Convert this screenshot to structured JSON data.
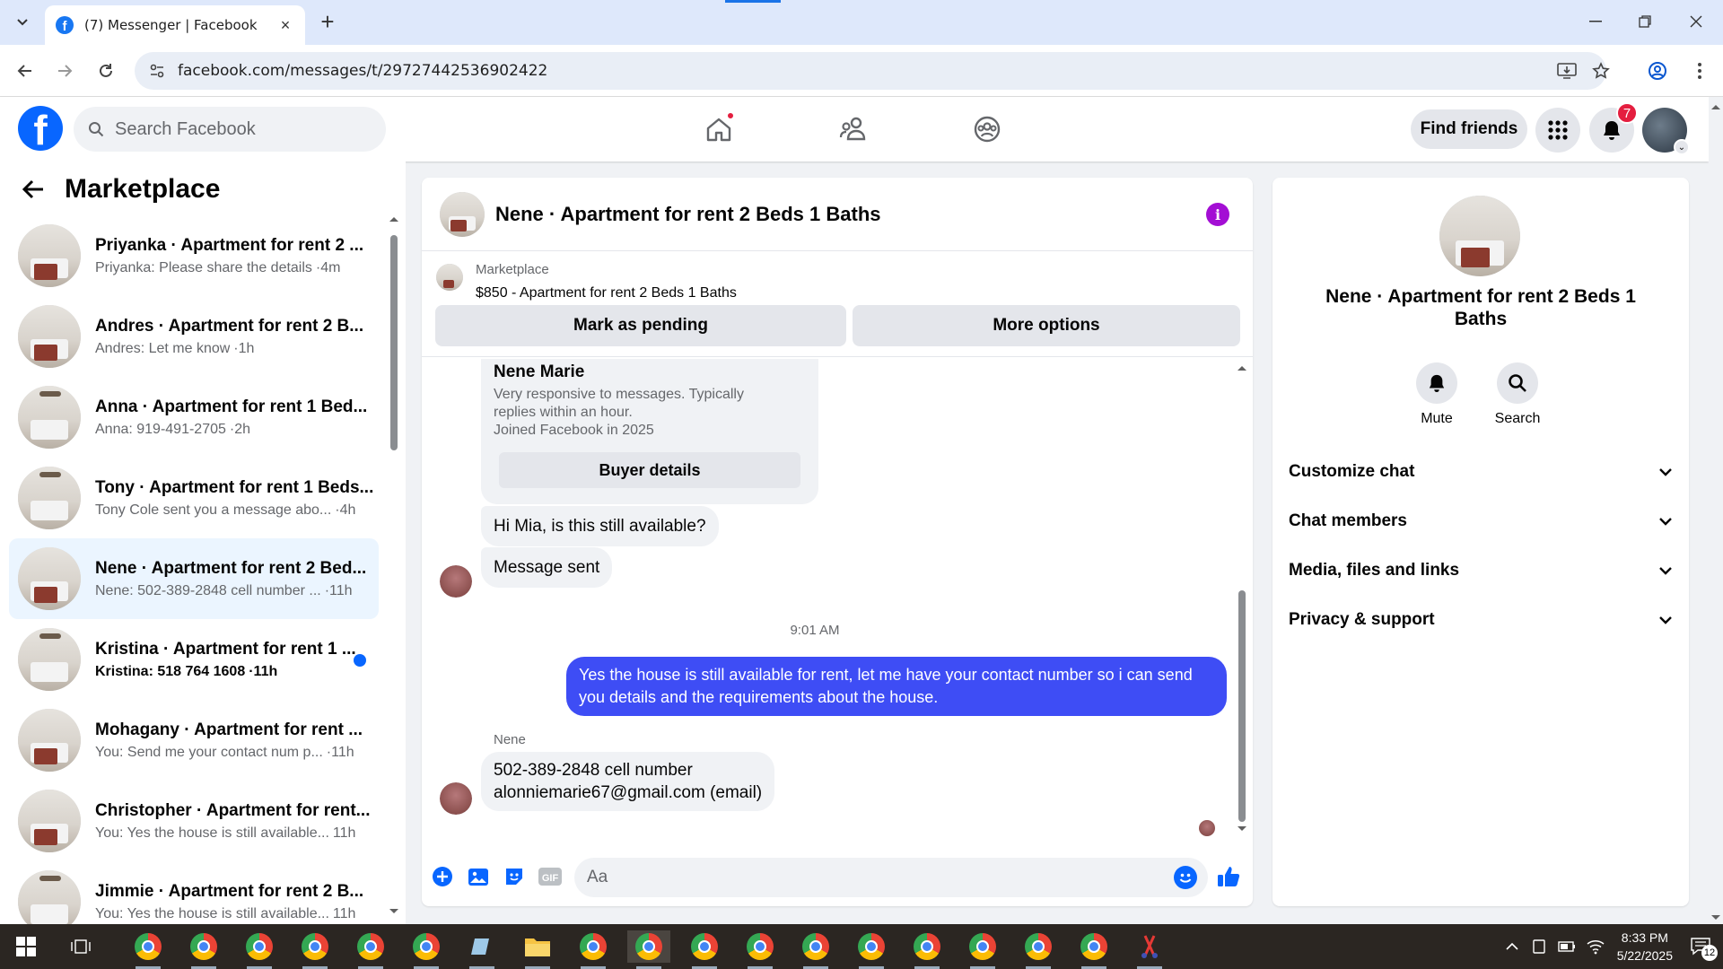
{
  "browser": {
    "tab_title": "(7) Messenger | Facebook",
    "url": "facebook.com/messages/t/29727442536902422",
    "accent": "#1a73e8"
  },
  "header": {
    "search_placeholder": "Search Facebook",
    "find_friends": "Find friends",
    "notification_count": "7",
    "brand_color": "#0866ff"
  },
  "sidebar": {
    "title": "Marketplace",
    "conversations": [
      {
        "name": "Priyanka · Apartment for rent 2 ...",
        "preview": "Priyanka: Please share the details",
        "time": "·4m",
        "unread": false,
        "active": false
      },
      {
        "name": "Andres · Apartment for rent 2 B...",
        "preview": "Andres: Let me know",
        "time": "·1h",
        "unread": false,
        "active": false
      },
      {
        "name": "Anna · Apartment for rent 1 Bed...",
        "preview": "Anna: 919-491-2705",
        "time": "·2h",
        "unread": false,
        "active": false
      },
      {
        "name": "Tony · Apartment for rent 1 Beds...",
        "preview": "Tony Cole sent you a message abo...",
        "time": "·4h",
        "unread": false,
        "active": false
      },
      {
        "name": "Nene · Apartment for rent 2 Bed...",
        "preview": "Nene: 502-389-2848 cell number ...",
        "time": "·11h",
        "unread": false,
        "active": true
      },
      {
        "name": "Kristina · Apartment for rent 1 ...",
        "preview": "Kristina: 518 764 1608",
        "time": "·11h",
        "unread": true,
        "active": false
      },
      {
        "name": "Mohagany · Apartment for rent ...",
        "preview": "You: Send me your contact num p...",
        "time": "·11h",
        "unread": false,
        "active": false
      },
      {
        "name": "Christopher · Apartment for rent...",
        "preview": "You: Yes the house is still available...",
        "time": "11h",
        "unread": false,
        "active": false
      },
      {
        "name": "Jimmie · Apartment for rent 2 B...",
        "preview": "You: Yes the house is still available...",
        "time": "11h",
        "unread": false,
        "active": false
      }
    ]
  },
  "chat": {
    "title": "Nene · Apartment for rent 2 Beds 1 Baths",
    "marketplace_label": "Marketplace",
    "listing": "$850 - Apartment for rent 2 Beds 1 Baths",
    "mark_pending": "Mark as pending",
    "more_options": "More options",
    "buyer_card": {
      "name": "Nene Marie",
      "desc1": "Very responsive to messages. Typically replies within an hour.",
      "desc2": "Joined Facebook in 2025",
      "button": "Buyer details"
    },
    "msg1": "Hi Mia, is this still available?",
    "msg2": "Message sent",
    "time": "9:01 AM",
    "reply_line1": "Yes the house is still available for rent, let me have your contact number so i can send",
    "reply_line2": "you details and the requirements about the house.",
    "sender": "Nene",
    "msg3_line1": "502-389-2848 cell number",
    "msg3_line2": "alonniemarie67@gmail.com (email)",
    "composer_placeholder": "Aa",
    "sent_bubble_color": "#3e4df5"
  },
  "details": {
    "title": "Nene · Apartment for rent 2 Beds 1 Baths",
    "mute": "Mute",
    "search": "Search",
    "sections": [
      "Customize chat",
      "Chat members",
      "Media, files and links",
      "Privacy & support"
    ]
  },
  "taskbar": {
    "time": "8:33 PM",
    "date": "5/22/2025",
    "notif": "12"
  }
}
